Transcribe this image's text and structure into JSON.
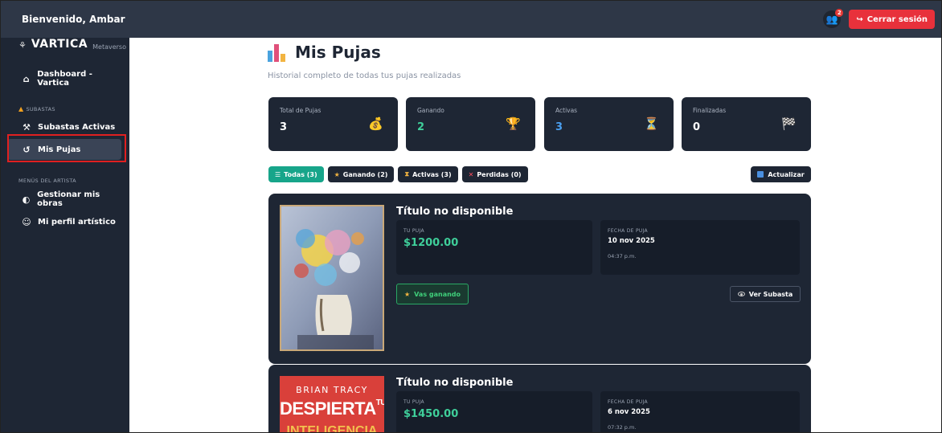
{
  "topbar": {
    "welcome": "Bienvenido, Ambar",
    "notification_count": "2",
    "logout_label": "Cerrar sesión"
  },
  "sidebar": {
    "brand_name": "VARTICA",
    "brand_sub": "Metaverso",
    "dashboard_label": "Dashboard - Vartica",
    "section_auctions": "SUBASTAS",
    "active_auctions_label": "Subastas Activas",
    "my_bids_label": "Mis Pujas",
    "section_artist": "MENÚS DEL ARTISTA",
    "manage_works_label": "Gestionar mis obras",
    "artist_profile_label": "Mi perfil artístico"
  },
  "page": {
    "title": "Mis Pujas",
    "subtitle": "Historial completo de todas tus pujas realizadas"
  },
  "stats": [
    {
      "label": "Total de Pujas",
      "value": "3",
      "emoji": "💰",
      "color": "#ffffff"
    },
    {
      "label": "Ganando",
      "value": "2",
      "emoji": "🏆",
      "color": "#3fcf9a"
    },
    {
      "label": "Activas",
      "value": "3",
      "emoji": "⏳",
      "color": "#4a9ff0"
    },
    {
      "label": "Finalizadas",
      "value": "0",
      "emoji": "🏁",
      "color": "#ffffff"
    }
  ],
  "filters": {
    "all": "Todas (3)",
    "winning": "Ganando (2)",
    "active": "Activas (3)",
    "lost": "Perdidas (0)",
    "refresh": "Actualizar"
  },
  "bids": [
    {
      "title": "Título no disponible",
      "bid_label": "TU PUJA",
      "amount": "$1200.00",
      "date_label": "FECHA DE PUJA",
      "date": "10 nov 2025",
      "time": "04:37 p.m.",
      "status": "Vas ganando",
      "view_label": "Ver Subasta"
    },
    {
      "title": "Título no disponible",
      "bid_label": "TU PUJA",
      "amount": "$1450.00",
      "date_label": "FECHA DE PUJA",
      "date": "6 nov 2025",
      "time": "07:32 p.m.",
      "book_author": "BRIAN TRACY",
      "book_title": "DESPIERTA",
      "book_title_small": "TU",
      "book_subtitle": "INTELIGENCIA"
    }
  ],
  "colors": {
    "topbar": "#2e3747",
    "sidebar": "#1e2634",
    "card": "#1e2634",
    "accent_green": "#3fcf9a",
    "accent_teal": "#17a58a",
    "logout_red": "#e8313b",
    "highlight_red": "#e02020"
  }
}
